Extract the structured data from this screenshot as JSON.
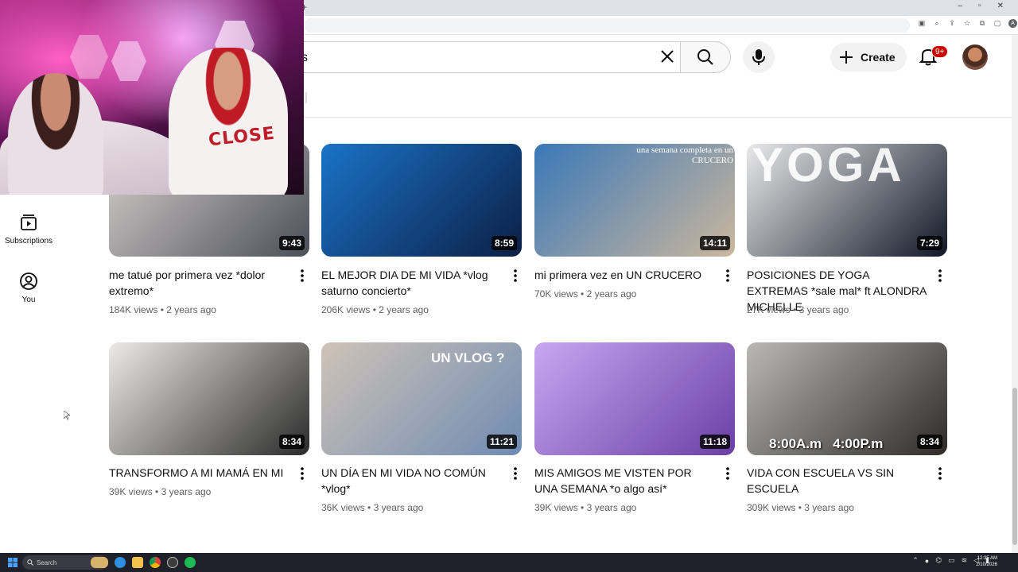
{
  "browser": {
    "new_tab_glyph": "+",
    "window_controls": [
      "–",
      "▫",
      "✕"
    ],
    "extensions": [
      "extension-icon",
      "zoom-icon",
      "share-icon",
      "bookmark-star-icon",
      "extensions-puzzle-icon",
      "sidebar-icon"
    ],
    "profile_initial": "A"
  },
  "header": {
    "search_value": "s",
    "create_label": "Create",
    "notifications_badge": "9+"
  },
  "guide": [
    {
      "label": "Subscriptions",
      "icon": "subscriptions-icon"
    },
    {
      "label": "You",
      "icon": "you-icon"
    }
  ],
  "webcam": {
    "shirt_text": "CLOSE"
  },
  "videos": [
    {
      "title": "me tatué por primera vez *dolor extremo*",
      "views": "184K views",
      "age": "2 years ago",
      "duration": "9:43",
      "colors": [
        "#d9d2cf",
        "#4b4f58"
      ]
    },
    {
      "title": "EL MEJOR DIA DE MI VIDA *vlog saturno concierto*",
      "views": "206K views",
      "age": "2 years ago",
      "duration": "8:59",
      "colors": [
        "#1a73c8",
        "#0c1f45"
      ]
    },
    {
      "title": "mi primera vez en UN CRUCERO",
      "views": "70K views",
      "age": "2 years ago",
      "duration": "14:11",
      "colors": [
        "#3a78b8",
        "#cbb79d"
      ],
      "overlay": "una semana completa en un CRUCERO"
    },
    {
      "title": "POSICIONES DE YOGA EXTREMAS *sale mal* ft ALONDRA MICHELLE",
      "views": "27K views",
      "age": "3 years ago",
      "duration": "7:29",
      "colors": [
        "#e9e9ea",
        "#111827"
      ],
      "overlay": "YOGA"
    },
    {
      "title": "TRANSFORMO A MI MAMÁ EN MI",
      "views": "39K views",
      "age": "3 years ago",
      "duration": "8:34",
      "colors": [
        "#eceae6",
        "#2b2b2b"
      ]
    },
    {
      "title": "UN DÍA EN MI VIDA NO COMÚN *vlog*",
      "views": "36K views",
      "age": "3 years ago",
      "duration": "11:21",
      "colors": [
        "#cfc3b7",
        "#6f8bb2"
      ],
      "overlay": "UN VLOG ?"
    },
    {
      "title": "MIS AMIGOS ME VISTEN POR UNA SEMANA *o algo así*",
      "views": "39K views",
      "age": "3 years ago",
      "duration": "11:18",
      "colors": [
        "#c8a7f2",
        "#6b3fa6"
      ]
    },
    {
      "title": "VIDA CON ESCUELA VS SIN ESCUELA",
      "views": "309K views",
      "age": "3 years ago",
      "duration": "8:34",
      "colors": [
        "#b9b8b6",
        "#2e2b2a"
      ],
      "overlay": "8:00A.m   4:00P.m"
    }
  ],
  "taskbar": {
    "search_label": "Search",
    "time": "12:35 AM",
    "date": "2/10/2026",
    "apps": [
      "folder-app",
      "edge-app",
      "explorer-app",
      "chrome-app",
      "obs-app",
      "spotify-app"
    ]
  }
}
